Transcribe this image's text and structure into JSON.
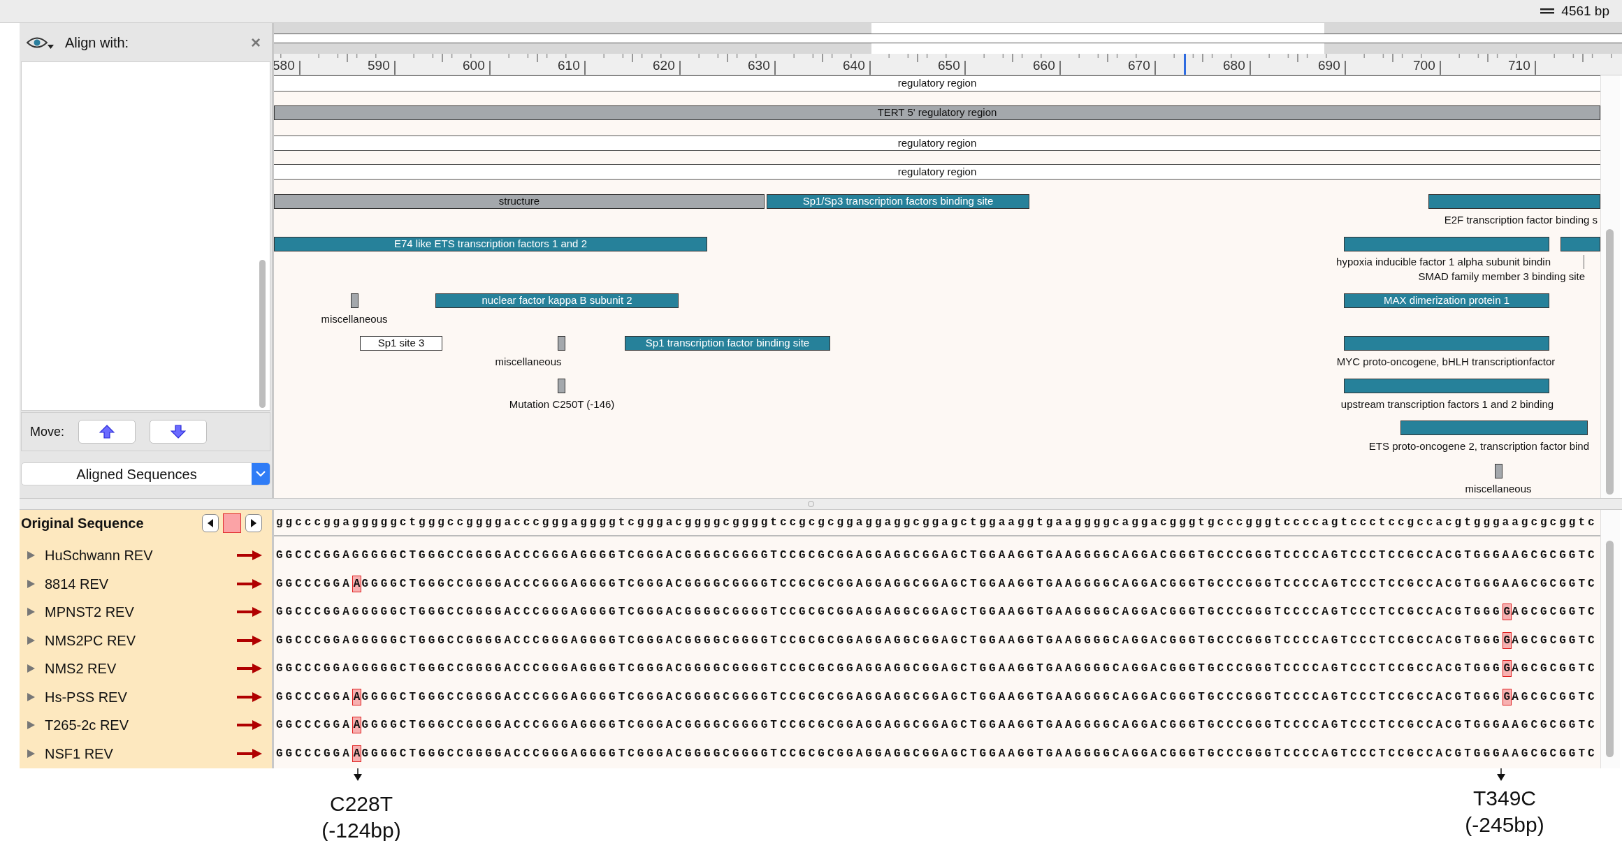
{
  "top_bar": {
    "length": "4561 bp"
  },
  "align_panel": {
    "title": "Align with:",
    "close": "×",
    "move_label": "Move:",
    "dropdown": "Aligned Sequences"
  },
  "ruler": {
    "labels": [
      "580",
      "590",
      "600",
      "610",
      "620",
      "630",
      "640",
      "650",
      "660",
      "670",
      "680",
      "690",
      "700",
      "710"
    ]
  },
  "features": [
    {
      "kind": "band",
      "label": "regulatory region",
      "color": "#ffffff"
    },
    {
      "kind": "bar",
      "label": "TERT 5' regulatory region",
      "color": "#a4a8ac"
    },
    {
      "kind": "band",
      "label": "regulatory region",
      "color": "#ffffff"
    },
    {
      "kind": "band",
      "label": "regulatory region",
      "color": "#ffffff"
    },
    {
      "kind": "bar",
      "label": "structure",
      "color": "#a4a8ac"
    },
    {
      "kind": "bar",
      "label": "Sp1/Sp3 transcription factors binding site",
      "color": "#26819a"
    },
    {
      "kind": "range",
      "label": "E2F transcription factor binding s",
      "color": "#26819a"
    },
    {
      "kind": "bar",
      "label": "E74 like ETS transcription factors 1 and 2",
      "color": "#26819a"
    },
    {
      "kind": "range",
      "label": "hypoxia inducible factor 1 alpha subunit bindin",
      "color": "#26819a"
    },
    {
      "kind": "range",
      "label": "SMAD family member 3 binding site",
      "color": "#26819a"
    },
    {
      "kind": "marker",
      "label": "miscellaneous",
      "color": "#a4a8ac"
    },
    {
      "kind": "bar",
      "label": "nuclear factor kappa B subunit 2",
      "color": "#26819a"
    },
    {
      "kind": "bar",
      "label": "MAX dimerization protein 1",
      "color": "#26819a"
    },
    {
      "kind": "bar",
      "label": "Sp1 site 3",
      "color": "#ffffff"
    },
    {
      "kind": "marker",
      "label": "miscellaneous",
      "color": "#a4a8ac"
    },
    {
      "kind": "bar",
      "label": "Sp1 transcription factor binding site",
      "color": "#26819a"
    },
    {
      "kind": "range",
      "label": "MYC proto-oncogene, bHLH transcriptionfactor",
      "color": "#26819a"
    },
    {
      "kind": "marker",
      "label": "Mutation C250T (-146)",
      "color": "#a4a8ac"
    },
    {
      "kind": "range",
      "label": "upstream transcription factors 1 and 2 binding",
      "color": "#26819a"
    },
    {
      "kind": "range",
      "label": "ETS proto-oncogene 2, transcription factor bind",
      "color": "#26819a"
    },
    {
      "kind": "marker",
      "label": "miscellaneous",
      "color": "#a4a8ac"
    }
  ],
  "original_sequence": {
    "label": "Original Sequence",
    "sequence": "ggcccggagggggctgggccggggacccgggaggggtcgggacggggcggggtccgcgcggaggaggcggagctggaaggtgaaggggcaggacgggtgcccgggtccccagtccctccgccacgtgggaagcgcggtc"
  },
  "rows": [
    {
      "name": "HuSchwann REV",
      "expanded": false,
      "segments": [
        {
          "text": "GGCCCGGAGGGGGCTGGGCCGGGGACCCGGGAGGGGTCGGGACGGGGCGGGGTCCGCGCGGAGGAGGCGGAGCTGGAAGGTGAAGGGGCAGGACGGGTGCCCGGGTCCCCAGTCCCTCCGCCACGTGGGAAGCGCGGTC",
          "changed": false
        }
      ]
    },
    {
      "name": "8814 REV",
      "expanded": false,
      "segments": [
        {
          "text": "GGCCCGGA",
          "changed": false
        },
        {
          "text": "A",
          "changed": true
        },
        {
          "text": "GGGGCTGGGCCGGGGACCCGGGAGGGGTCGGGACGGGGCGGGGTCCGCGCGGAGGAGGCGGAGCTGGAAGGTGAAGGGGCAGGACGGGTGCCCGGGTCCCCAGTCCCTCCGCCACGTGGGAAGCGCGGTC",
          "changed": false
        }
      ]
    },
    {
      "name": "MPNST2 REV",
      "expanded": false,
      "segments": [
        {
          "text": "GGCCCGGAGGGGGCTGGGCCGGGGACCCGGGAGGGGTCGGGACGGGGCGGGGTCCGCGCGGAGGAGGCGGAGCTGGAAGGTGAAGGGGCAGGACGGGTGCCCGGGTCCCCAGTCCCTCCGCCACGTGGG",
          "changed": false
        },
        {
          "text": "G",
          "changed": true
        },
        {
          "text": "AGCGCGGTC",
          "changed": false
        }
      ]
    },
    {
      "name": "NMS2PC REV",
      "expanded": false,
      "segments": [
        {
          "text": "GGCCCGGAGGGGGCTGGGCCGGGGACCCGGGAGGGGTCGGGACGGGGCGGGGTCCGCGCGGAGGAGGCGGAGCTGGAAGGTGAAGGGGCAGGACGGGTGCCCGGGTCCCCAGTCCCTCCGCCACGTGGG",
          "changed": false
        },
        {
          "text": "G",
          "changed": true
        },
        {
          "text": "AGCGCGGTC",
          "changed": false
        }
      ]
    },
    {
      "name": "NMS2 REV",
      "expanded": false,
      "segments": [
        {
          "text": "GGCCCGGAGGGGGCTGGGCCGGGGACCCGGGAGGGGTCGGGACGGGGCGGGGTCCGCGCGGAGGAGGCGGAGCTGGAAGGTGAAGGGGCAGGACGGGTGCCCGGGTCCCCAGTCCCTCCGCCACGTGGG",
          "changed": false
        },
        {
          "text": "G",
          "changed": true
        },
        {
          "text": "AGCGCGGTC",
          "changed": false
        }
      ]
    },
    {
      "name": "Hs-PSS REV",
      "expanded": false,
      "segments": [
        {
          "text": "GGCCCGGA",
          "changed": false
        },
        {
          "text": "A",
          "changed": true
        },
        {
          "text": "GGGGCTGGGCCGGGGACCCGGGAGGGGTCGGGACGGGGCGGGGTCCGCGCGGAGGAGGCGGAGCTGGAAGGTGAAGGGGCAGGACGGGTGCCCGGGTCCCCAGTCCCTCCGCCACGTGGG",
          "changed": false
        },
        {
          "text": "G",
          "changed": true
        },
        {
          "text": "AGCGCGGTC",
          "changed": false
        }
      ]
    },
    {
      "name": "T265-2c REV",
      "expanded": false,
      "segments": [
        {
          "text": "GGCCCGGA",
          "changed": false
        },
        {
          "text": "A",
          "changed": true
        },
        {
          "text": "GGGGCTGGGCCGGGGACCCGGGAGGGGTCGGGACGGGGCGGGGTCCGCGCGGAGGAGGCGGAGCTGGAAGGTGAAGGGGCAGGACGGGTGCCCGGGTCCCCAGTCCCTCCGCCACGTGGGAAGCGCGGTC",
          "changed": false
        }
      ]
    },
    {
      "name": "NSF1 REV",
      "expanded": false,
      "segments": [
        {
          "text": "GGCCCGGA",
          "changed": false
        },
        {
          "text": "A",
          "changed": true
        },
        {
          "text": "GGGGCTGGGCCGGGGACCCGGGAGGGGTCGGGACGGGGCGGGGTCCGCGCGGAGGAGGCGGAGCTGGAAGGTGAAGGGGCAGGACGGGTGCCCGGGTCCCCAGTCCCTCCGCCACGTGGGAAGCGCGGTC",
          "changed": false
        }
      ]
    }
  ],
  "annotations": [
    {
      "mutation": "C228T",
      "offset": "(-124bp)"
    },
    {
      "mutation": "T349C",
      "offset": "(-245bp)"
    }
  ]
}
